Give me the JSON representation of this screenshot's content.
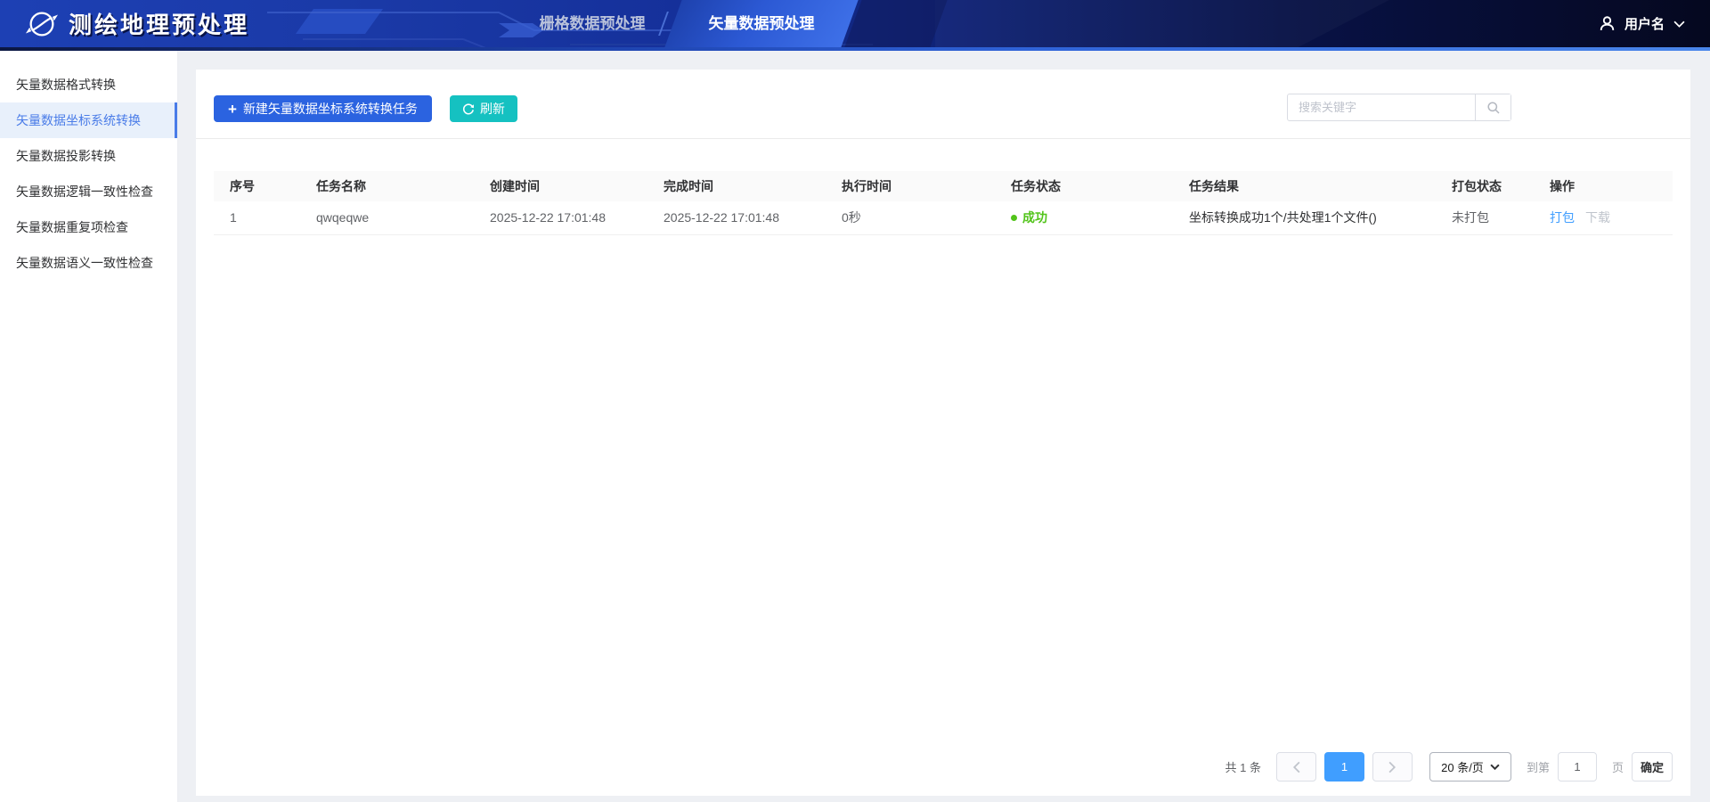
{
  "header": {
    "app_title": "测绘地理预处理",
    "tabs": [
      {
        "label": "栅格数据预处理",
        "active": false
      },
      {
        "label": "矢量数据预处理",
        "active": true
      }
    ],
    "user": {
      "name": "用户名"
    }
  },
  "sidebar": {
    "items": [
      {
        "label": "矢量数据格式转换",
        "active": false
      },
      {
        "label": "矢量数据坐标系统转换",
        "active": true
      },
      {
        "label": "矢量数据投影转换",
        "active": false
      },
      {
        "label": "矢量数据逻辑一致性检查",
        "active": false
      },
      {
        "label": "矢量数据重复项检查",
        "active": false
      },
      {
        "label": "矢量数据语义一致性检查",
        "active": false
      }
    ]
  },
  "toolbar": {
    "new_task_label": "新建矢量数据坐标系统转换任务",
    "refresh_label": "刷新",
    "search_placeholder": "搜索关键字"
  },
  "table": {
    "columns": [
      "序号",
      "任务名称",
      "创建时间",
      "完成时间",
      "执行时间",
      "任务状态",
      "任务结果",
      "打包状态",
      "操作"
    ],
    "rows": [
      {
        "index": "1",
        "name": "qwqeqwe",
        "created": "2025-12-22 17:01:48",
        "finished": "2025-12-22 17:01:48",
        "duration": "0秒",
        "status": "成功",
        "result": "坐标转换成功1个/共处理1个文件()",
        "pack_status": "未打包",
        "actions": {
          "pack": "打包",
          "download": "下载"
        }
      }
    ]
  },
  "pagination": {
    "total_label": "共 1 条",
    "current_page": "1",
    "page_size_label": "20 条/页",
    "goto_prefix": "到第",
    "goto_value": "1",
    "goto_suffix": "页",
    "confirm_label": "确定"
  },
  "colors": {
    "header_blue": "#15309a",
    "primary_button": "#2b63e0",
    "refresh_teal": "#15c1c1",
    "success_green": "#52c41a",
    "link_blue": "#409eff",
    "active_page_blue": "#409eff",
    "sidebar_active_bg": "#e8f0fb",
    "sidebar_active_text": "#4a7ce8"
  }
}
